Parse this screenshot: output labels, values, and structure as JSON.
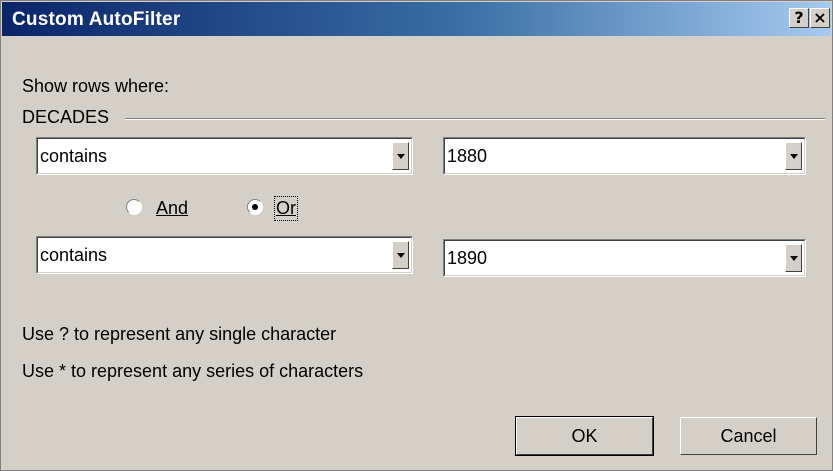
{
  "window": {
    "title": "Custom AutoFilter",
    "help_glyph": "?",
    "close_glyph": "×"
  },
  "intro_label": "Show rows where:",
  "field_name": "DECADES",
  "criteria": [
    {
      "operator": "contains",
      "value": "1880"
    },
    {
      "operator": "contains",
      "value": "1890"
    }
  ],
  "logic": {
    "and_label": "And",
    "or_label": "Or",
    "selected": "Or"
  },
  "hints": [
    "Use ? to represent any single character",
    "Use * to represent any series of characters"
  ],
  "buttons": {
    "ok": "OK",
    "cancel": "Cancel"
  },
  "colors": {
    "titlebar_start": "#0a246a",
    "titlebar_end": "#a6caf0",
    "dialog_bg": "#d4d0c8"
  },
  "icons": [
    "help-icon",
    "close-icon",
    "dropdown-arrow-icon"
  ]
}
